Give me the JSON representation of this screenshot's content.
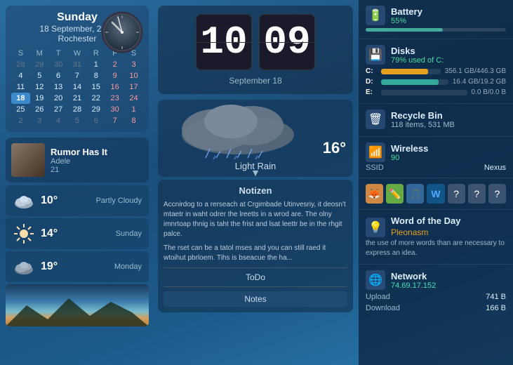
{
  "calendar": {
    "day_name": "Sunday",
    "date_line": "18 September, 2011",
    "city": "Rochester",
    "days_of_week": [
      "S",
      "M",
      "T",
      "W",
      "R",
      "F",
      "S"
    ],
    "weeks": [
      [
        "28",
        "29",
        "30",
        "31",
        "1",
        "2",
        "3"
      ],
      [
        "4",
        "5",
        "6",
        "7",
        "8",
        "9",
        "10"
      ],
      [
        "11",
        "12",
        "13",
        "14",
        "15",
        "16",
        "17"
      ],
      [
        "18",
        "19",
        "20",
        "21",
        "22",
        "23",
        "24"
      ],
      [
        "25",
        "26",
        "27",
        "28",
        "29",
        "30",
        "1"
      ],
      [
        "2",
        "3",
        "4",
        "5",
        "6",
        "7",
        "8"
      ]
    ],
    "today_date": "18",
    "today_week": 3,
    "today_col": 0
  },
  "music": {
    "title": "Rumor Has It",
    "artist": "Adele",
    "track": "21"
  },
  "weather_rows": [
    {
      "temp": "10°",
      "desc": "Partly Cloudy",
      "day": ""
    },
    {
      "temp": "14°",
      "desc": "",
      "day": "Sunday"
    },
    {
      "temp": "19°",
      "desc": "",
      "day": "Monday"
    }
  ],
  "flip_clock": {
    "hours": "10",
    "minutes": "09",
    "date_label": "September  18"
  },
  "weather_main": {
    "temp": "16°",
    "label": "Light Rain"
  },
  "notes": {
    "title": "Notizen",
    "text1": "Accnirdog to a rerseach at Crgimbade Utinvesriy, it deosn't mtaetr in waht odrer the lreetts in a wrod are. The olny imnrtoap thnig is taht the frist and lsat leettr be in the rhgit palce.",
    "text2": "The rset can be a tatol mses and you can still raed it wtoihut pbrloem. Tihs is bseacue the ha...",
    "todo_label": "ToDo",
    "notes_btn": "Notes"
  },
  "right_panel": {
    "battery": {
      "title": "Battery",
      "percent": "55%",
      "fill": 55
    },
    "disks": {
      "title": "Disks",
      "subtitle": "79% used of C:",
      "drives": [
        {
          "letter": "C:",
          "fill_class": "disk-fill-c",
          "size": "356.1 GB/446.3 GB"
        },
        {
          "letter": "D:",
          "fill_class": "disk-fill-d",
          "size": "16.4 GB/19.2 GB"
        },
        {
          "letter": "E:",
          "fill_class": "disk-fill-e",
          "size": "0.0 B/0.0 B"
        }
      ]
    },
    "recycle": {
      "title": "Recycle Bin",
      "subtitle": "118  items, 531 MB"
    },
    "wireless": {
      "title": "Wireless",
      "signal": "90",
      "ssid_label": "SSID",
      "ssid_value": "Nexus"
    },
    "quick_icons": [
      "🦊",
      "✏️",
      "🎵",
      "W",
      "?",
      "?",
      "?"
    ],
    "word_of_day": {
      "title": "Word of the Day",
      "word": "Pleonasm",
      "definition": "the use of more words than are necessary to express an idea."
    },
    "network": {
      "title": "Network",
      "ip": "74.69.17.152",
      "upload_label": "Upload",
      "upload_val": "741 B",
      "download_label": "Download",
      "download_val": "166 B"
    }
  }
}
